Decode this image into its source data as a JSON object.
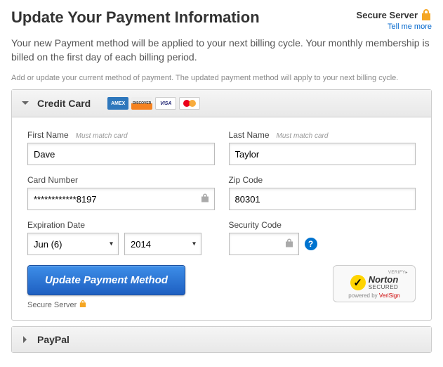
{
  "header": {
    "title": "Update Your Payment Information",
    "secure_label": "Secure Server",
    "secure_link": "Tell me more"
  },
  "subtitle": "Your new Payment method will be applied to your next billing cycle. Your monthly membership is billed on the first day of each billing period.",
  "helper": "Add or update your current method of payment. The updated payment method will apply to your next billing cycle.",
  "cc": {
    "title": "Credit Card",
    "first_name": {
      "label": "First Name",
      "hint": "Must match card",
      "value": "Dave"
    },
    "last_name": {
      "label": "Last Name",
      "hint": "Must match card",
      "value": "Taylor"
    },
    "card_number": {
      "label": "Card Number",
      "value": "************8197"
    },
    "zip": {
      "label": "Zip Code",
      "value": "80301"
    },
    "expiration": {
      "label": "Expiration Date",
      "month": "Jun (6)",
      "year": "2014"
    },
    "security": {
      "label": "Security Code",
      "value": ""
    },
    "submit": "Update Payment Method",
    "secure_footer": "Secure Server"
  },
  "norton": {
    "verify": "VERIFY▸",
    "brand": "Norton",
    "secured": "SECURED",
    "powered": "powered by ",
    "verisign": "VeriSign"
  },
  "paypal": {
    "title": "PayPal"
  },
  "card_logos": {
    "amex": "AMEX",
    "discover": "DISCOVER",
    "visa": "VISA"
  }
}
